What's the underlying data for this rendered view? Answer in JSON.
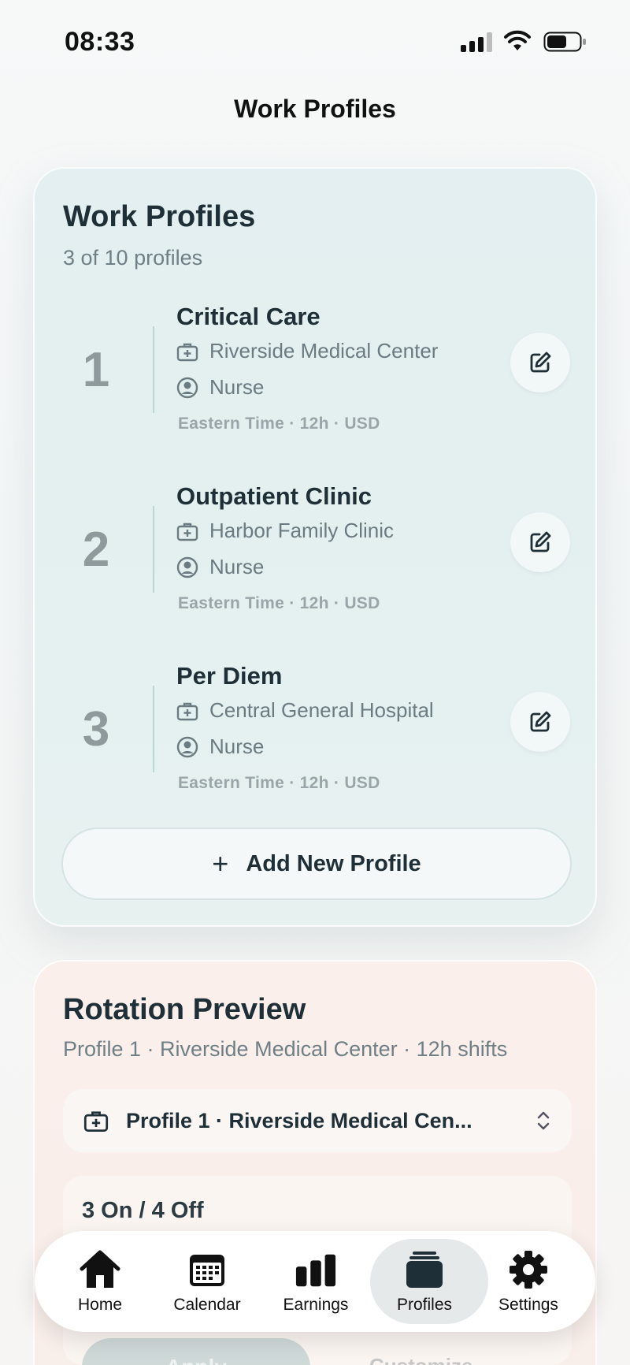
{
  "status": {
    "time": "08:33"
  },
  "nav": {
    "title": "Work Profiles"
  },
  "profiles_card": {
    "title": "Work Profiles",
    "subtitle": "3 of 10 profiles",
    "profiles": [
      {
        "number": "1",
        "name": "Critical Care",
        "facility": "Riverside Medical Center",
        "role": "Nurse",
        "meta": "Eastern Time · 12h · USD"
      },
      {
        "number": "2",
        "name": "Outpatient Clinic",
        "facility": "Harbor Family Clinic",
        "role": "Nurse",
        "meta": "Eastern Time · 12h · USD"
      },
      {
        "number": "3",
        "name": "Per Diem",
        "facility": "Central General Hospital",
        "role": "Nurse",
        "meta": "Eastern Time · 12h · USD"
      }
    ],
    "add_label": "Add New Profile"
  },
  "rotation": {
    "title": "Rotation Preview",
    "subtitle": "Profile 1 · Riverside Medical Center · 12h shifts",
    "selected_profile": "Profile 1 · Riverside Medical Cen...",
    "pattern": "3 On / 4 Off",
    "apply_label": "Apply",
    "customize_label": "Customize"
  },
  "tabs": [
    {
      "label": "Home",
      "icon": "home-icon"
    },
    {
      "label": "Calendar",
      "icon": "calendar-icon"
    },
    {
      "label": "Earnings",
      "icon": "bar-chart-icon"
    },
    {
      "label": "Profiles",
      "icon": "profiles-stack-icon",
      "active": true
    },
    {
      "label": "Settings",
      "icon": "gear-icon"
    }
  ],
  "colors": {
    "accent": "#1f2f38",
    "profiles_card_bg": "#e3eff0",
    "rotation_card_bg": "#fbefeb"
  }
}
